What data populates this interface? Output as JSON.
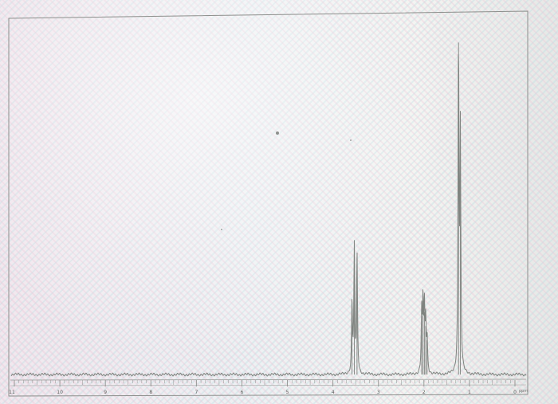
{
  "chart_data": {
    "type": "line",
    "title": "",
    "xlabel": "ppm",
    "ylabel": "",
    "x_reversed": true,
    "xlim": [
      11,
      0
    ],
    "ylim": [
      0,
      100
    ],
    "tick_labels": [
      "11",
      "10",
      "9",
      "8",
      "7",
      "6",
      "5",
      "4",
      "3",
      "2",
      "1",
      "0"
    ],
    "line_color": "#7f837f",
    "peaks": [
      {
        "x": 3.58,
        "y": 20
      },
      {
        "x": 3.53,
        "y": 36
      },
      {
        "x": 3.47,
        "y": 34
      },
      {
        "x": 2.05,
        "y": 17
      },
      {
        "x": 2.02,
        "y": 20
      },
      {
        "x": 1.99,
        "y": 18
      },
      {
        "x": 1.96,
        "y": 14
      },
      {
        "x": 1.93,
        "y": 10
      },
      {
        "x": 1.24,
        "y": 96
      },
      {
        "x": 1.2,
        "y": 68
      }
    ]
  }
}
